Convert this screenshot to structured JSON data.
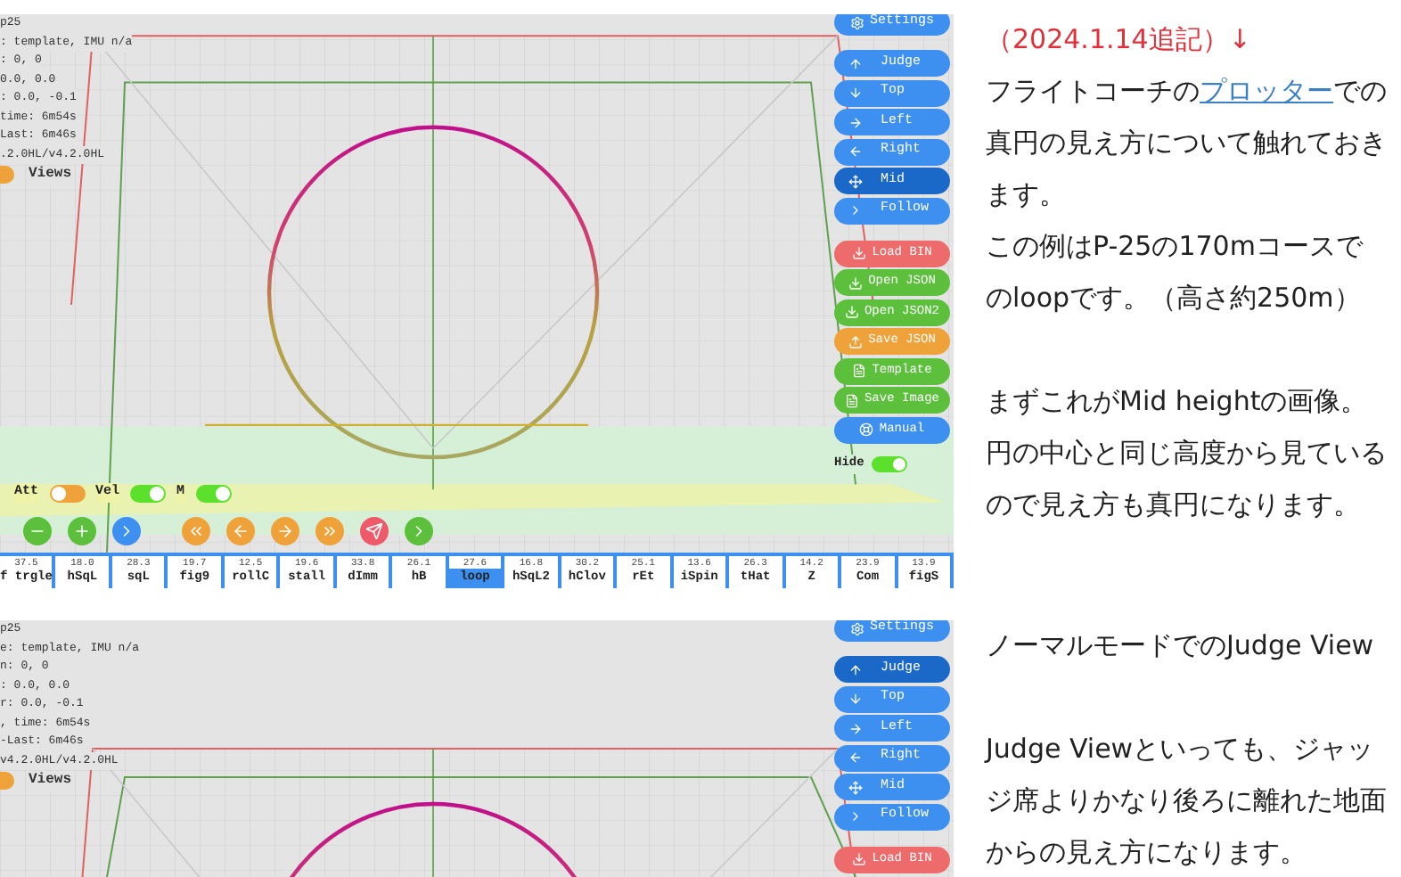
{
  "sections": [
    {
      "shot": {
        "info_lines": [
          "p25",
          ": template, IMU n/a",
          ": 0, 0",
          "0.0, 0.0",
          ": 0.0, -0.1",
          "time: 6m54s",
          "Last: 6m46s",
          ".2.0HL/v4.2.0HL"
        ],
        "views": {
          "label": "Views",
          "on": false
        },
        "settings": "Settings",
        "view_buttons": [
          {
            "label": "Judge",
            "selected": false
          },
          {
            "label": "Top",
            "selected": false
          },
          {
            "label": "Left",
            "selected": false
          },
          {
            "label": "Right",
            "selected": false
          },
          {
            "label": "Mid",
            "selected": true
          },
          {
            "label": "Follow",
            "selected": false
          }
        ],
        "file_buttons": [
          {
            "label": "Load BIN",
            "color": "#ee6b6b"
          },
          {
            "label": "Open JSON",
            "color": "#5cc03c"
          },
          {
            "label": "Open JSON2",
            "color": "#5cc03c"
          },
          {
            "label": "Save JSON",
            "color": "#f0a23a"
          },
          {
            "label": "Template",
            "color": "#5cc03c"
          },
          {
            "label": "Save Image",
            "color": "#5cc03c"
          },
          {
            "label": "Manual",
            "color": "#3d8ff0"
          }
        ],
        "hide": {
          "label": "Hide",
          "on": true
        },
        "toggles": [
          {
            "label": "Att",
            "on": false
          },
          {
            "label": "Vel",
            "on": true
          },
          {
            "label": "M",
            "on": true
          }
        ],
        "round_buttons": [
          {
            "color": "#5cc03c"
          },
          {
            "color": "#5cc03c"
          },
          {
            "color": "#3d8ff0"
          },
          {
            "color": "#f0a23a"
          },
          {
            "color": "#f0a23a"
          },
          {
            "color": "#f0a23a"
          },
          {
            "color": "#f0a23a"
          },
          {
            "color": "#ee5a6a"
          },
          {
            "color": "#5cc03c"
          }
        ],
        "timeline": [
          {
            "value": "37.5",
            "label": "f trgle",
            "selected": false
          },
          {
            "value": "18.0",
            "label": "hSqL",
            "selected": false
          },
          {
            "value": "28.3",
            "label": "sqL",
            "selected": false
          },
          {
            "value": "19.7",
            "label": "fig9",
            "selected": false
          },
          {
            "value": "12.5",
            "label": "rollC",
            "selected": false
          },
          {
            "value": "19.6",
            "label": "stall",
            "selected": false
          },
          {
            "value": "33.8",
            "label": "dImm",
            "selected": false
          },
          {
            "value": "26.1",
            "label": "hB",
            "selected": false
          },
          {
            "value": "27.6",
            "label": "loop",
            "selected": true
          },
          {
            "value": "16.8",
            "label": "hSqL2",
            "selected": false
          },
          {
            "value": "30.2",
            "label": "hClov",
            "selected": false
          },
          {
            "value": "25.1",
            "label": "rEt",
            "selected": false
          },
          {
            "value": "13.6",
            "label": "iSpin",
            "selected": false
          },
          {
            "value": "26.3",
            "label": "tHat",
            "selected": false
          },
          {
            "value": "14.2",
            "label": "Z",
            "selected": false
          },
          {
            "value": "23.9",
            "label": "Com",
            "selected": false
          },
          {
            "value": "13.9",
            "label": "figS",
            "selected": false
          }
        ]
      },
      "notes": [
        {
          "kind": "added",
          "text": "（2024.1.14追記）↓"
        },
        {
          "kind": "linked",
          "before": "フライトコーチの",
          "link": "プロッター",
          "after": "での真円の見え方について触れておきます。"
        },
        {
          "kind": "plain",
          "text": "この例はP-25の170mコースでのloopです。（高さ約250m）"
        },
        {
          "kind": "gap"
        },
        {
          "kind": "plain",
          "text": "まずこれがMid heightの画像。円の中心と同じ高度から見ているので見え方も真円になります。"
        }
      ]
    },
    {
      "shot": {
        "info_lines": [
          "p25",
          "e: template, IMU n/a",
          "n: 0, 0",
          ": 0.0, 0.0",
          "r: 0.0, -0.1",
          ", time: 6m54s",
          "-Last: 6m46s",
          "v4.2.0HL/v4.2.0HL"
        ],
        "views": {
          "label": "Views",
          "on": false
        },
        "settings": "Settings",
        "view_buttons": [
          {
            "label": "Judge",
            "selected": true
          },
          {
            "label": "Top",
            "selected": false
          },
          {
            "label": "Left",
            "selected": false
          },
          {
            "label": "Right",
            "selected": false
          },
          {
            "label": "Mid",
            "selected": false
          },
          {
            "label": "Follow",
            "selected": false
          }
        ],
        "file_buttons": [
          {
            "label": "Load BIN",
            "color": "#ee6b6b"
          }
        ]
      },
      "notes": [
        {
          "kind": "plain",
          "text": "ノーマルモードでのJudge View"
        },
        {
          "kind": "gap"
        },
        {
          "kind": "plain",
          "text": "Judge Viewといっても、ジャッジ席よりかなり後ろに離れた地面からの見え方になります。"
        }
      ]
    }
  ]
}
